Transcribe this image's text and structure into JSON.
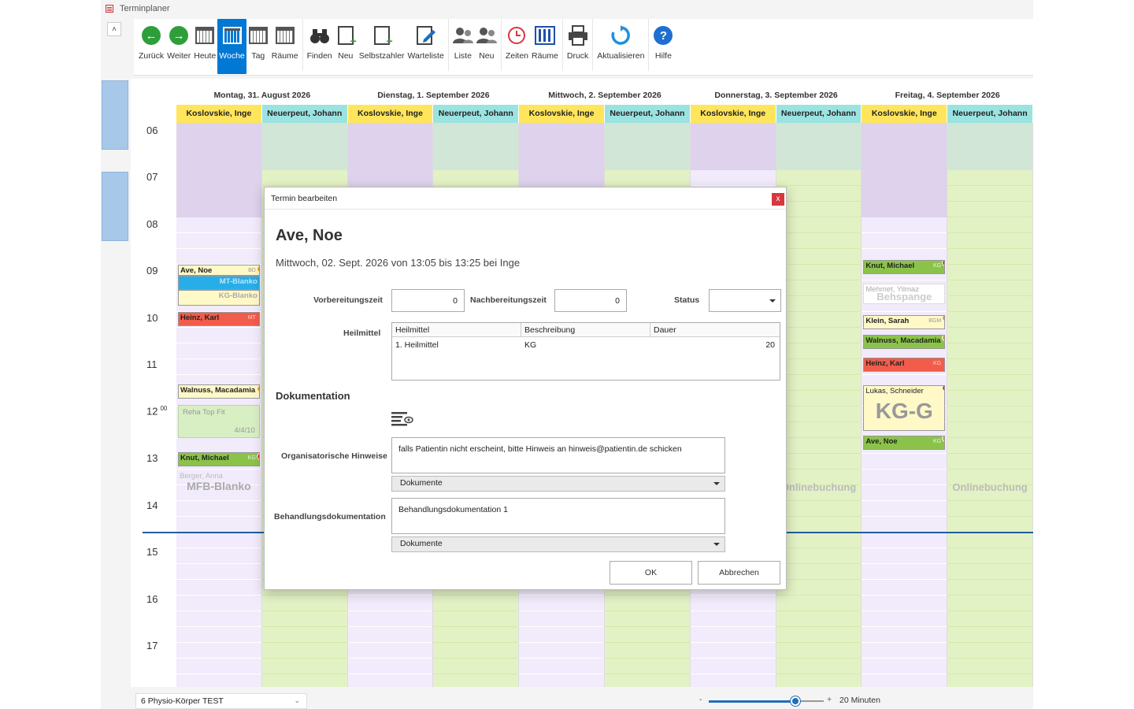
{
  "window": {
    "title": "Terminplaner"
  },
  "toolbar": {
    "buttons": [
      {
        "label": "Zurück",
        "icon": "arrow-left-icon"
      },
      {
        "label": "Weiter",
        "icon": "arrow-right-icon"
      },
      {
        "label": "Heute",
        "icon": "calendar-today-icon"
      },
      {
        "label": "Woche",
        "icon": "calendar-week-icon",
        "active": true
      },
      {
        "label": "Tag",
        "icon": "calendar-day-icon"
      },
      {
        "label": "Räume",
        "icon": "calendar-rooms-icon"
      },
      {
        "label": "Finden",
        "icon": "binoculars-icon"
      },
      {
        "label": "Neu",
        "icon": "new-document-icon"
      },
      {
        "label": "Selbstzahler",
        "icon": "self-payer-icon"
      },
      {
        "label": "Warteliste",
        "icon": "waitlist-icon"
      },
      {
        "label": "Liste",
        "icon": "people-list-icon"
      },
      {
        "label": "Neu",
        "icon": "new-person-icon"
      },
      {
        "label": "Zeiten",
        "icon": "clock-icon"
      },
      {
        "label": "Räume",
        "icon": "rooms-icon"
      },
      {
        "label": "Druck",
        "icon": "printer-icon"
      },
      {
        "label": "Aktualisieren",
        "icon": "refresh-icon"
      },
      {
        "label": "Hilfe",
        "icon": "help-icon"
      }
    ]
  },
  "calendar": {
    "days": [
      "Montag, 31. August 2026",
      "Dienstag, 1. September 2026",
      "Mittwoch, 2. September 2026",
      "Donnerstag, 3. September 2026",
      "Freitag, 4. September 2026"
    ],
    "resources": [
      "Koslovskie, Inge",
      "Neuerpeut, Johann"
    ],
    "hours": [
      "06",
      "07",
      "08",
      "09",
      "10",
      "11",
      "12",
      "13",
      "14",
      "15",
      "16",
      "17"
    ],
    "hour12_minutes": "00",
    "appointments": {
      "mon_ave": "Ave, Noe",
      "mon_ave_tag": "BD",
      "mon_mt": "MT-Blanko",
      "mon_kg": "KG-Blanko",
      "mon_heinz": "Heinz, Karl",
      "mon_heinz_tag": "MT",
      "mon_walnuss": "Walnuss, Macadamia",
      "mon_reha": "Reha Top Fit",
      "mon_reha_count": "4/4/10",
      "mon_knut": "Knut, Michael",
      "mon_knut_tag": "KG",
      "mon_berger": "Berger, Anna",
      "mon_mfb": "MFB-Blanko",
      "fri_knut": "Knut, Michael",
      "fri_knut_tag": "KG",
      "fri_mehmet": "Mehmet, Yilmaz",
      "fri_beh": "Behspange",
      "fri_klein": "Klein, Sarah",
      "fri_klein_tag": "BGM",
      "fri_walnuss": "Walnuss, Macadamia",
      "fri_heinz": "Heinz, Karl",
      "fri_heinz_tag": "KG",
      "fri_lukas": "Lukas, Schneider",
      "fri_lukas_big": "KG-G",
      "fri_ave": "Ave, Noe",
      "fri_ave_tag": "KG",
      "online": "Onlinebuchung"
    }
  },
  "statusbar": {
    "location": "6 Physio-Körper TEST",
    "zoom_minus": "-",
    "zoom_plus": "+",
    "zoom_label": "20 Minuten",
    "zoom_level": 0.75
  },
  "dialog": {
    "title": "Termin bearbeiten",
    "close": "x",
    "patient": "Ave, Noe",
    "subtitle": "Mittwoch, 02. Sept. 2026 von 13:05 bis 13:25 bei Inge",
    "prep_label": "Vorbereitungszeit",
    "prep_value": "0",
    "post_label": "Nachbereitungszeit",
    "post_value": "0",
    "status_label": "Status",
    "status_value": "",
    "heilmittel_label": "Heilmittel",
    "table_headers": [
      "Heilmittel",
      "Beschreibung",
      "Dauer"
    ],
    "table_rows": [
      [
        "1. Heilmittel",
        "KG",
        "20"
      ]
    ],
    "doc_section": "Dokumentation",
    "org_label": "Organisatorische Hinweise",
    "org_text": "falls Patientin nicht erscheint, bitte Hinweis an hinweis@patientin.de schicken",
    "org_dropdown": "Dokumente",
    "treat_label": "Behandlungsdokumentation",
    "treat_text": "Behandlungsdokumentation 1",
    "treat_dropdown": "Dokumente",
    "ok": "OK",
    "cancel": "Abbrechen"
  },
  "colors": {
    "accent": "#0078d4",
    "koslovskie_header": "#ffe55c",
    "neuerpeut_header": "#9be3e0",
    "close": "#d9363e",
    "appt_green": "#8bc34a",
    "appt_red": "#f25c4a"
  }
}
